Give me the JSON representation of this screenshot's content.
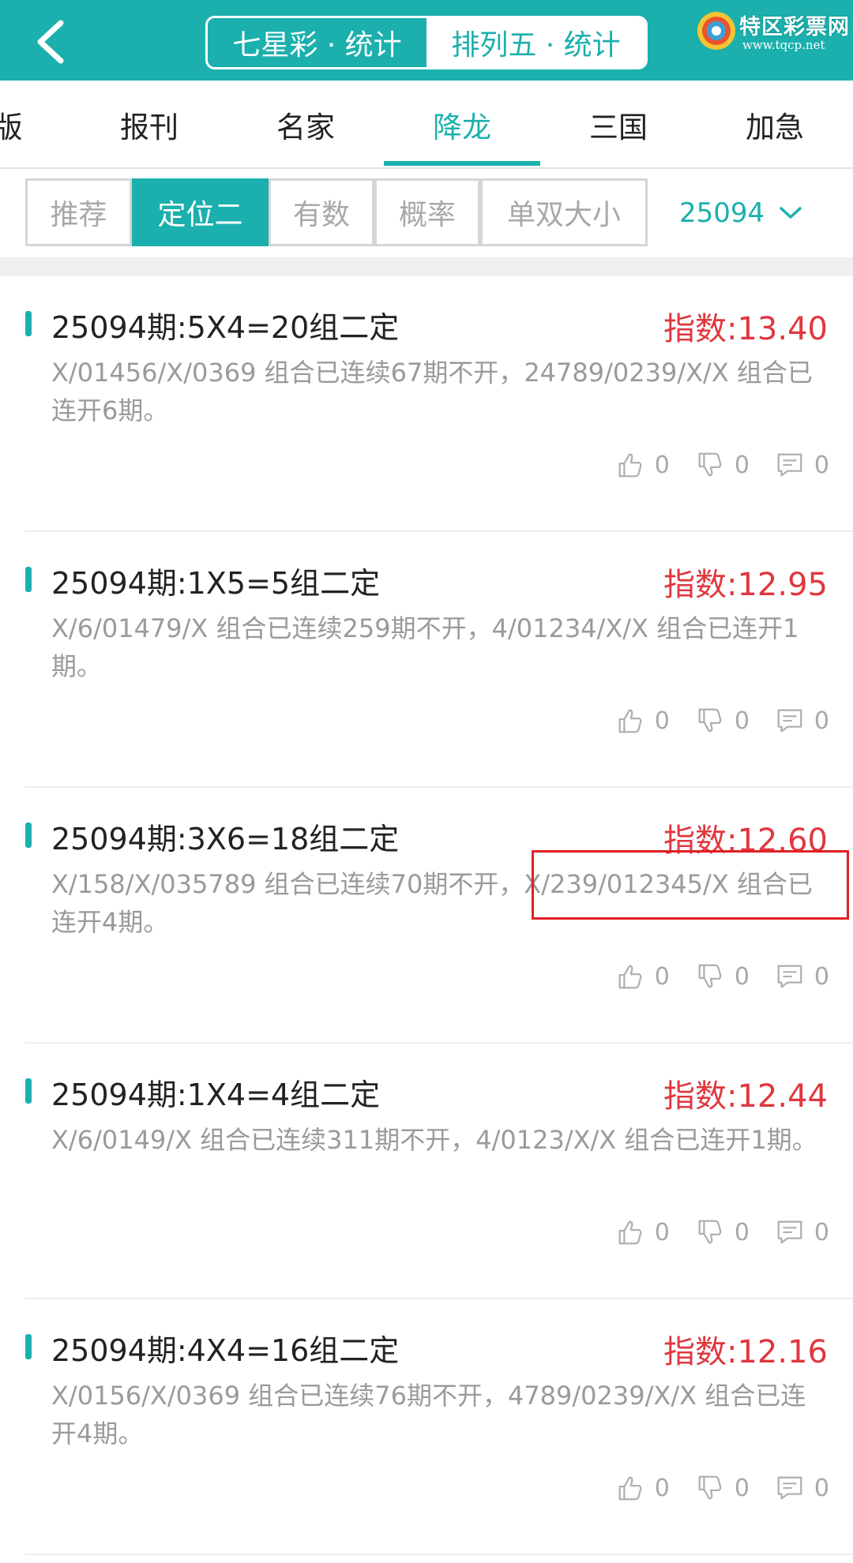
{
  "header": {
    "tabs": [
      {
        "label": "七星彩 · 统计",
        "active": true
      },
      {
        "label": "排列五 · 统计",
        "active": false
      }
    ],
    "logo": {
      "text": "特区彩票网",
      "url": "www.tqcp.net"
    }
  },
  "category_tabs": [
    {
      "label": "版",
      "active": false
    },
    {
      "label": "报刊",
      "active": false
    },
    {
      "label": "名家",
      "active": false
    },
    {
      "label": "降龙",
      "active": true
    },
    {
      "label": "三国",
      "active": false
    },
    {
      "label": "加急",
      "active": false
    }
  ],
  "sub_tabs": [
    {
      "label": "推荐",
      "active": false
    },
    {
      "label": "定位二",
      "active": true
    },
    {
      "label": "有数",
      "active": false
    },
    {
      "label": "概率",
      "active": false
    },
    {
      "label": "单双大小",
      "active": false
    }
  ],
  "issue_selector": {
    "value": "25094"
  },
  "items": [
    {
      "title": "25094期:5X4=20组二定",
      "index": "指数:13.40",
      "desc": "X/01456/X/0369 组合已连续67期不开，24789/0239/X/X 组合已连开6期。",
      "likes": "0",
      "dislikes": "0",
      "comments": "0"
    },
    {
      "title": "25094期:1X5=5组二定",
      "index": "指数:12.95",
      "desc": "X/6/01479/X 组合已连续259期不开，4/01234/X/X 组合已连开1期。",
      "likes": "0",
      "dislikes": "0",
      "comments": "0"
    },
    {
      "title": "25094期:3X6=18组二定",
      "index": "指数:12.60",
      "desc": "X/158/X/035789 组合已连续70期不开，X/239/012345/X 组合已连开4期。",
      "likes": "0",
      "dislikes": "0",
      "comments": "0"
    },
    {
      "title": "25094期:1X4=4组二定",
      "index": "指数:12.44",
      "desc": "X/6/0149/X 组合已连续311期不开，4/0123/X/X 组合已连开1期。",
      "likes": "0",
      "dislikes": "0",
      "comments": "0"
    },
    {
      "title": "25094期:4X4=16组二定",
      "index": "指数:12.16",
      "desc": "X/0156/X/0369 组合已连续76期不开，4789/0239/X/X 组合已连开4期。",
      "likes": "0",
      "dislikes": "0",
      "comments": "0"
    }
  ],
  "colors": {
    "accent": "#1bb0ad",
    "index_red": "#e0373f",
    "highlight_red": "#e02027"
  }
}
